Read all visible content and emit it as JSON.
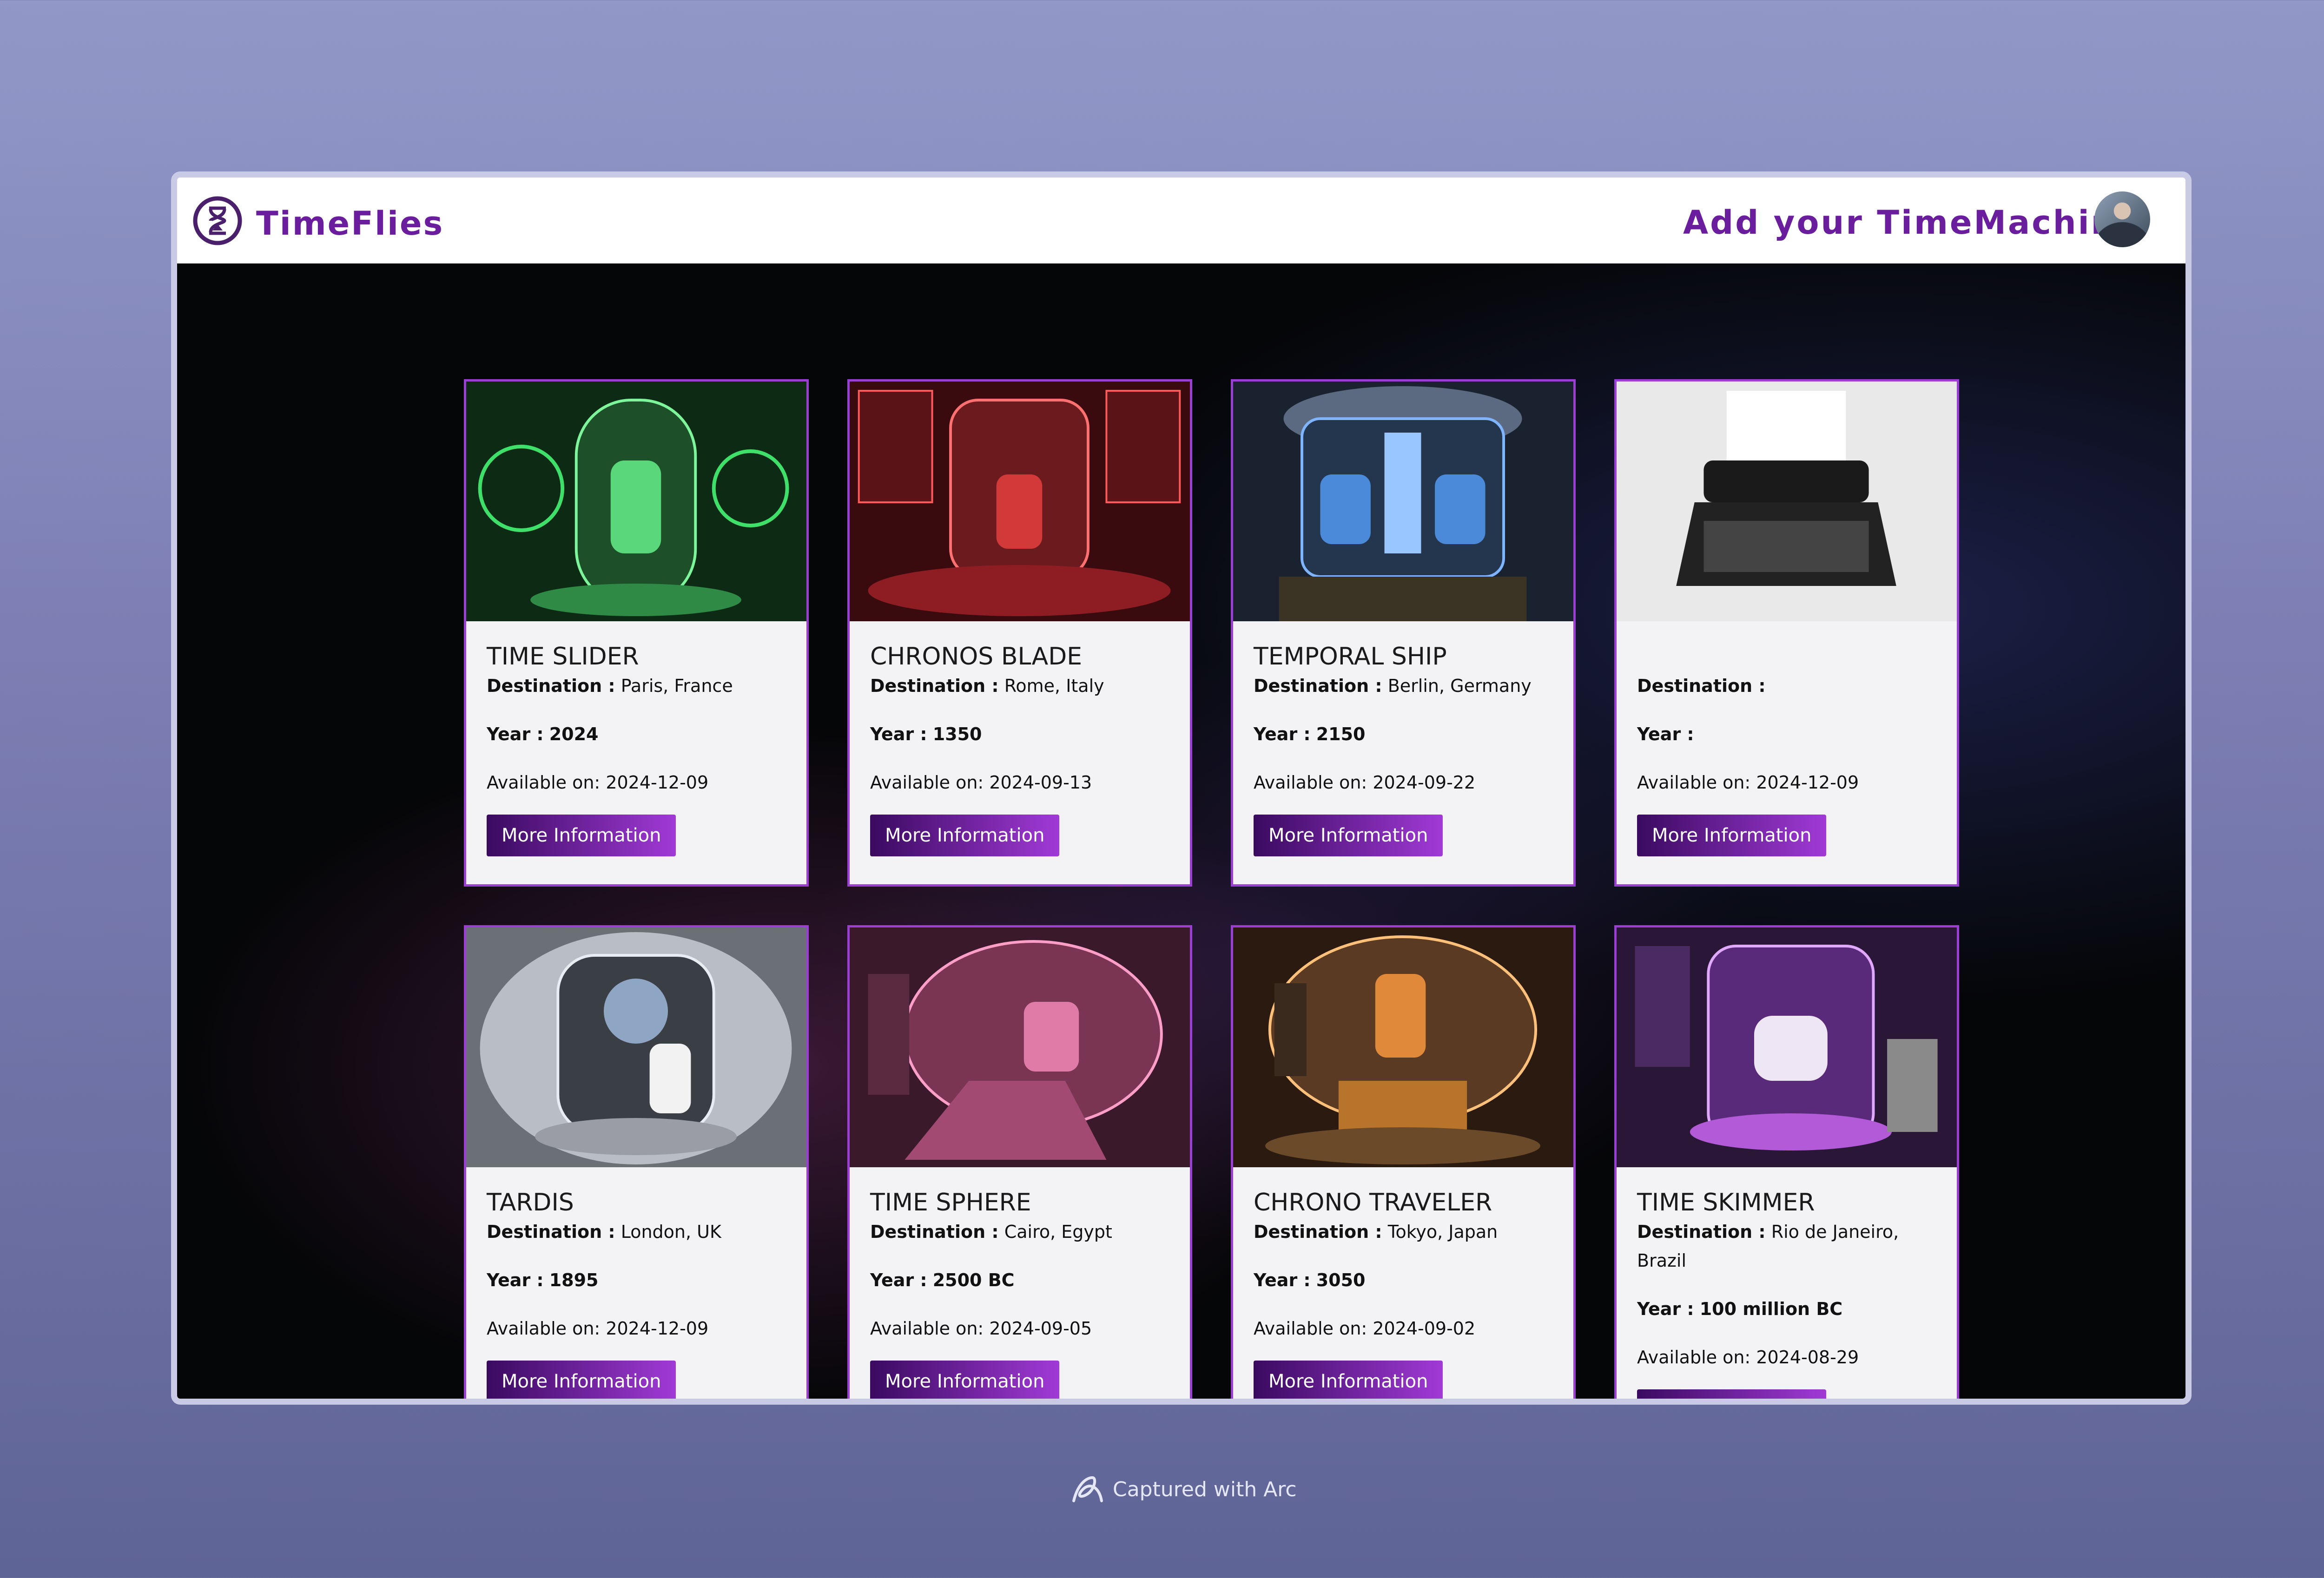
{
  "header": {
    "brand": "TimeFlies",
    "add_link": "Add your TimeMachine",
    "logo_icon": "hourglass-icon",
    "avatar_icon": "user-avatar"
  },
  "labels": {
    "destination": "Destination :",
    "year": "Year :",
    "available": "Available on:",
    "button": "More Information"
  },
  "cards": [
    {
      "title": "TIME SLIDER",
      "destination": "Paris, France",
      "year": "2024",
      "available": "2024-12-09",
      "color": "#36c24a"
    },
    {
      "title": "CHRONOS BLADE",
      "destination": "Rome, Italy",
      "year": "1350",
      "available": "2024-09-13",
      "color": "#d23a3a"
    },
    {
      "title": "TEMPORAL SHIP",
      "destination": "Berlin, Germany",
      "year": "2150",
      "available": "2024-09-22",
      "color": "#4a8ad8"
    },
    {
      "title": "",
      "destination": "",
      "year": "",
      "available": "2024-12-09",
      "color": "#2a2a2a"
    },
    {
      "title": "TARDIS",
      "destination": "London, UK",
      "year": "1895",
      "available": "2024-12-09",
      "color": "#c9ccd2"
    },
    {
      "title": "TIME SPHERE",
      "destination": "Cairo, Egypt",
      "year": "2500 BC",
      "available": "2024-09-05",
      "color": "#e07aa6"
    },
    {
      "title": "CHRONO TRAVELER",
      "destination": "Tokyo, Japan",
      "year": "3050",
      "available": "2024-09-02",
      "color": "#e0893a"
    },
    {
      "title": "TIME SKIMMER",
      "destination": "Rio de Janeiro, Brazil",
      "year": "100 million BC",
      "available": "2024-08-29",
      "color": "#b25ad8"
    }
  ],
  "footer": {
    "text": "Captured with Arc",
    "icon": "arc-logo-icon"
  }
}
